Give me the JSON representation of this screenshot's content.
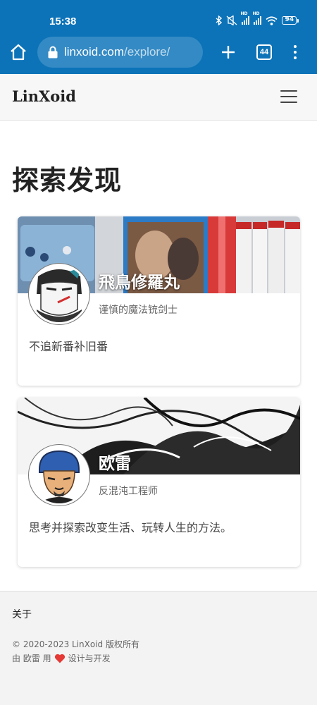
{
  "status_bar": {
    "time": "15:38",
    "battery": "94",
    "tech_label_1": "HD",
    "tech_label_2": "HD",
    "icons": [
      "bluetooth-icon",
      "mute-icon",
      "signal-icon",
      "signal-icon",
      "wifi-icon",
      "battery-icon"
    ]
  },
  "browser": {
    "url_domain": "linxoid.com",
    "url_path": "/explore/",
    "tab_count": "44",
    "icons": [
      "home-icon",
      "lock-icon",
      "plus-icon",
      "tabs-icon",
      "kebab-menu-icon"
    ]
  },
  "site": {
    "logo": "LinXoid",
    "menu_icon": "hamburger-menu-icon"
  },
  "main": {
    "title": "探索发现",
    "cards": [
      {
        "name": "飛鳥修羅丸",
        "subtitle": "谨慎的魔法铳剑士",
        "bio": "不追新番补旧番"
      },
      {
        "name": "欧雷",
        "subtitle": "反混沌工程师",
        "bio": "思考并探索改变生活、玩转人生的方法。"
      }
    ]
  },
  "footer": {
    "about": "关于",
    "copyright": "© 2020-2023 LinXoid 版权所有",
    "credit_prefix": "由 欧雷 用",
    "credit_suffix": "设计与开发",
    "heart_color": "#e53935"
  },
  "colors": {
    "browser_chrome": "#0c73b8",
    "header_bg": "#f7f7f7",
    "footer_bg": "#f3f3f3"
  }
}
